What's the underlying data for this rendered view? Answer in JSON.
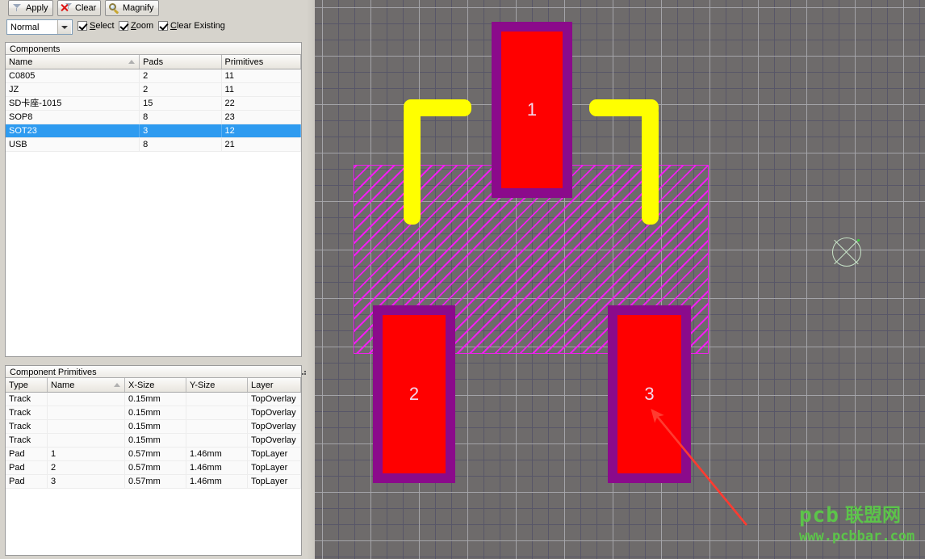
{
  "toolbar": {
    "apply_label": "Apply",
    "clear_label": "Clear",
    "magnify_label": "Magnify"
  },
  "options": {
    "mode_value": "Normal",
    "mode_options": [
      "Normal"
    ],
    "select_label": "Select",
    "select_checked": true,
    "zoom_label": "Zoom",
    "zoom_checked": true,
    "clear_existing_label": "Clear Existing",
    "clear_existing_checked": true
  },
  "components_panel": {
    "caption": "Components",
    "columns": [
      "Name",
      "Pads",
      "Primitives"
    ],
    "sorted_column": "Name",
    "rows": [
      {
        "name": "C0805",
        "pads": "2",
        "primitives": "11",
        "selected": false
      },
      {
        "name": "JZ",
        "pads": "2",
        "primitives": "11",
        "selected": false
      },
      {
        "name": "SD卡座-1015",
        "pads": "15",
        "primitives": "22",
        "selected": false
      },
      {
        "name": "SOP8",
        "pads": "8",
        "primitives": "23",
        "selected": false
      },
      {
        "name": "SOT23",
        "pads": "3",
        "primitives": "12",
        "selected": true
      },
      {
        "name": "USB",
        "pads": "8",
        "primitives": "21",
        "selected": false
      }
    ]
  },
  "primitives_panel": {
    "caption": "Component Primitives",
    "columns": [
      "Type",
      "Name",
      "X-Size",
      "Y-Size",
      "Layer"
    ],
    "sorted_column": "Name",
    "rows": [
      {
        "type": "Track",
        "name": "",
        "x_size": "0.15mm",
        "y_size": "",
        "layer": "TopOverlay"
      },
      {
        "type": "Track",
        "name": "",
        "x_size": "0.15mm",
        "y_size": "",
        "layer": "TopOverlay"
      },
      {
        "type": "Track",
        "name": "",
        "x_size": "0.15mm",
        "y_size": "",
        "layer": "TopOverlay"
      },
      {
        "type": "Track",
        "name": "",
        "x_size": "0.15mm",
        "y_size": "",
        "layer": "TopOverlay"
      },
      {
        "type": "Pad",
        "name": "1",
        "x_size": "0.57mm",
        "y_size": "1.46mm",
        "layer": "TopLayer"
      },
      {
        "type": "Pad",
        "name": "2",
        "x_size": "0.57mm",
        "y_size": "1.46mm",
        "layer": "TopLayer"
      },
      {
        "type": "Pad",
        "name": "3",
        "x_size": "0.57mm",
        "y_size": "1.46mm",
        "layer": "TopLayer"
      }
    ]
  },
  "canvas": {
    "pads": [
      {
        "designator": "1"
      },
      {
        "designator": "2"
      },
      {
        "designator": "3"
      }
    ],
    "colors": {
      "background": "#6e6b6b",
      "grid_minor": "#565668",
      "grid_major": "#a8a8ac",
      "pad_outline": "#8b0a8b",
      "pad_fill": "#ff0000",
      "silkscreen_track": "#ffff00",
      "keepout_hatch": "#f01ef0",
      "annotation_arrow": "#ff3b30",
      "origin_marker": "#c7e3c7"
    }
  },
  "watermark": {
    "logo_text": "pcb",
    "chinese_text": "联盟网",
    "url_text": "www.pcbbar.com",
    "color": "#5cc44a"
  }
}
